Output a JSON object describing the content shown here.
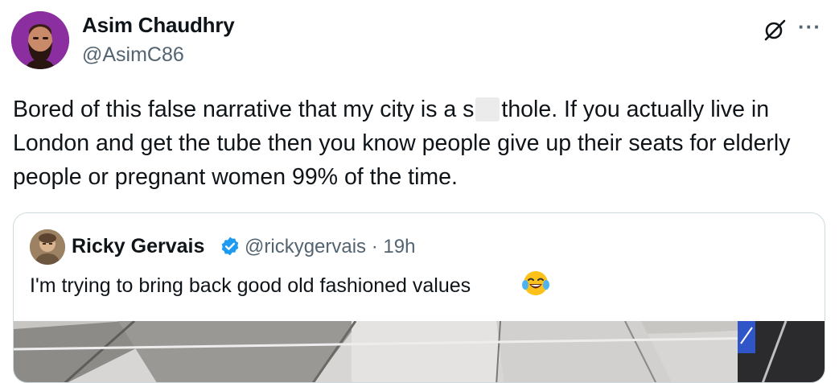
{
  "author": {
    "name": "Asim Chaudhry",
    "handle": "@AsimC86",
    "avatar_icon": "bearded-man-avatar",
    "avatar_bg": "#8b2fa0"
  },
  "actions": {
    "grok_icon": "grok-icon",
    "more_label": "···"
  },
  "tweet": {
    "text_before": "Bored of this false narrative that my city is a s",
    "text_after": "thole. If you actually live in London and get the tube then you know people give up their seats for elderly people or pregnant women 99% of the time."
  },
  "quote": {
    "name": "Ricky Gervais",
    "verified_icon": "verified-badge-icon",
    "handle_time": "@rickygervais · 19h",
    "text": "I'm trying to bring back good old fashioned values",
    "emoji": "laughing-crying-emoji",
    "image": "tube-ceiling-photo"
  },
  "colors": {
    "text": "#0f1419",
    "muted": "#536471",
    "border": "#cfd9de",
    "verified": "#1d9bf0"
  }
}
